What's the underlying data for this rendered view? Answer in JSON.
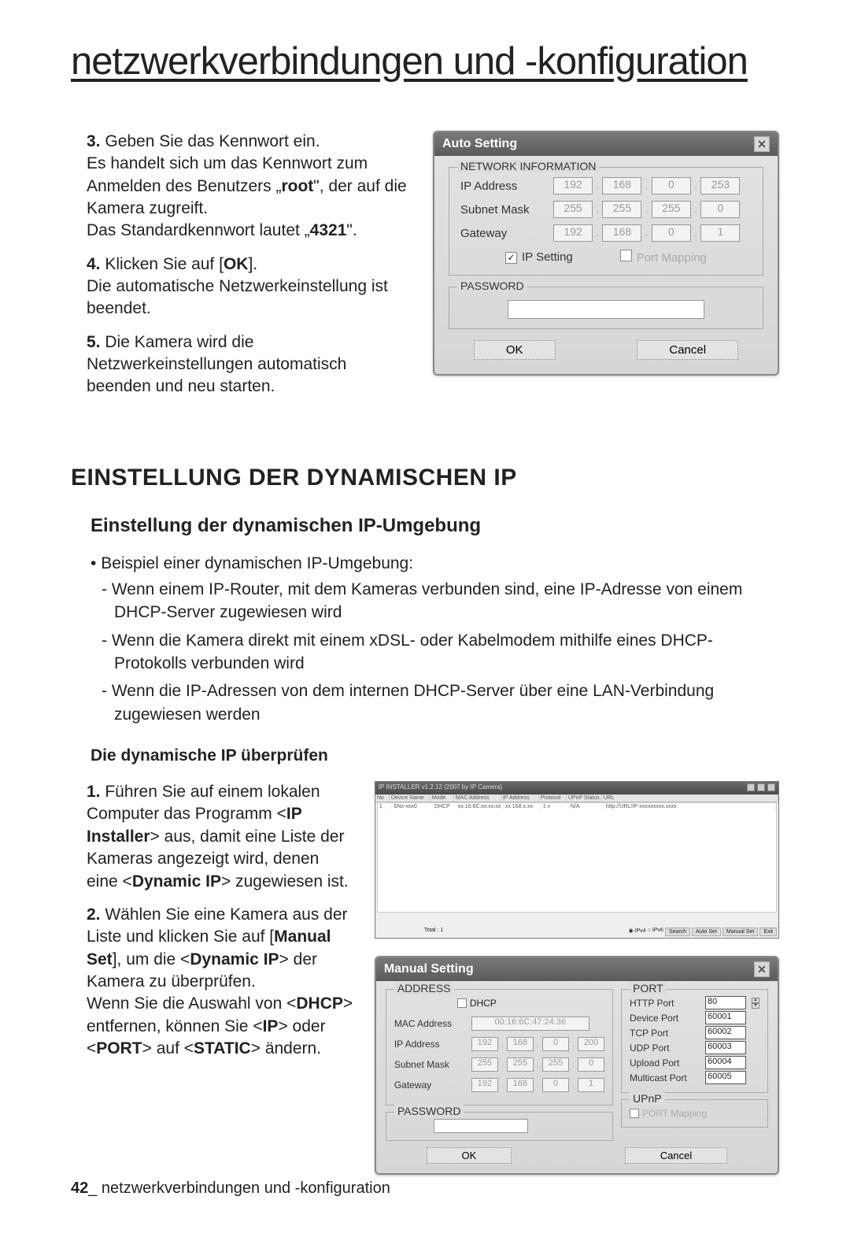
{
  "page": {
    "title": "netzwerkverbindungen und -konfiguration",
    "number": "42",
    "footer_suffix": "_ netzwerkverbindungen und -konfiguration"
  },
  "steps_top": {
    "s3": {
      "num": "3.",
      "l1": "Geben Sie das Kennwort ein.",
      "l2": "Es handelt sich um das Kennwort zum Anmelden des Benutzers „",
      "root": "root",
      "l3": "\", der auf die Kamera zugreift.",
      "l4": "Das Standardkennwort lautet „",
      "def": "4321",
      "l5": "\"."
    },
    "s4": {
      "num": "4.",
      "l1": "Klicken Sie auf [",
      "ok": "OK",
      "l2": "].",
      "l3": "Die automatische Netzwerkeinstellung ist beendet."
    },
    "s5": {
      "num": "5.",
      "l1": "Die Kamera wird die Netzwerkeinstellungen automatisch beenden und neu starten."
    }
  },
  "auto_dialog": {
    "title": "Auto Setting",
    "net_legend": "NETWORK INFORMATION",
    "ip_label": "IP Address",
    "subnet_label": "Subnet Mask",
    "gw_label": "Gateway",
    "ip": [
      "192",
      "168",
      "0",
      "253"
    ],
    "subnet": [
      "255",
      "255",
      "255",
      "0"
    ],
    "gw": [
      "192",
      "168",
      "0",
      "1"
    ],
    "ipsetting_label": "IP Setting",
    "portmapping_label": "Port Mapping",
    "pwd_legend": "PASSWORD",
    "ok": "OK",
    "cancel": "Cancel"
  },
  "section1_h1": "EINSTELLUNG DER DYNAMISCHEN IP",
  "section1_h2": "Einstellung der dynamischen IP-Umgebung",
  "bullet1": "Beispiel einer dynamischen IP-Umgebung:",
  "dash_list": [
    "Wenn einem IP-Router, mit dem Kameras verbunden sind, eine IP-Adresse von einem DHCP-Server zugewiesen wird",
    "Wenn die Kamera direkt mit einem xDSL- oder Kabelmodem mithilfe eines DHCP-Protokolls verbunden wird",
    "Wenn die IP-Adressen von dem internen DHCP-Server über eine LAN-Verbindung zugewiesen werden"
  ],
  "section1_h3": "Die dynamische IP überprüfen",
  "steps_bottom": {
    "s1": {
      "num": "1.",
      "t1": "Führen Sie auf einem lokalen Computer das Programm <",
      "b1": "IP Installer",
      "t2": "> aus, damit eine Liste der Kameras angezeigt wird, denen eine <",
      "b2": "Dynamic IP",
      "t3": "> zugewiesen ist."
    },
    "s2": {
      "num": "2.",
      "t1": "Wählen Sie eine Kamera aus der Liste und klicken Sie auf [",
      "b1": "Manual Set",
      "t2": "], um die <",
      "b2": "Dynamic IP",
      "t3": "> der Kamera zu überprüfen.",
      "t4": "Wenn Sie die Auswahl von <",
      "b3": "DHCP",
      "t5": "> entfernen, können Sie <",
      "b4": "IP",
      "t6": "> oder <",
      "b5": "PORT",
      "t7": "> auf <",
      "b6": "STATIC",
      "t8": "> ändern."
    }
  },
  "ipinstaller": {
    "title": "IP INSTALLER v1.2.12 (2007 by IP Camera)",
    "headers": [
      "No",
      "Device Name",
      "Mode",
      "MAC Address",
      "IP Address",
      "Protocol",
      "UPnP Status",
      "URL"
    ],
    "row": [
      "1",
      "SNx-xxx0",
      "DHCP",
      "xx:16:6C:xx:xx:xx",
      "xx.168.x.xx",
      "1  v",
      "N/A",
      "http://URL/IP-xxxxxxxxx.xxxx"
    ],
    "bottom_label": "Total : 1",
    "radio1": "IPv4",
    "radio2": "IPv6",
    "btn_search": "Search",
    "btn_autoset": "Auto Set",
    "btn_manualset": "Manual Set",
    "btn_exit": "Exit"
  },
  "manual_dialog": {
    "title": "Manual Setting",
    "address_legend": "ADDRESS",
    "dhcp_label": "DHCP",
    "mac_label": "MAC Address",
    "mac": "00:16:6C:47:24:36",
    "ip_label": "IP Address",
    "ip": [
      "192",
      "168",
      "0",
      "200"
    ],
    "subnet_label": "Subnet Mask",
    "subnet": [
      "255",
      "255",
      "255",
      "0"
    ],
    "gw_label": "Gateway",
    "gw": [
      "192",
      "168",
      "0",
      "1"
    ],
    "port_legend": "PORT",
    "http_label": "HTTP Port",
    "http": "80",
    "device_label": "Device Port",
    "device": "60001",
    "tcp_label": "TCP Port",
    "tcp": "60002",
    "udp_label": "UDP Port",
    "udp": "60003",
    "upload_label": "Upload Port",
    "upload": "60004",
    "mcast_label": "Multicast Port",
    "mcast": "60005",
    "pwd_legend": "PASSWORD",
    "upnp_legend": "UPnP",
    "portmapping_label": "PORT Mapping",
    "ok": "OK",
    "cancel": "Cancel"
  }
}
